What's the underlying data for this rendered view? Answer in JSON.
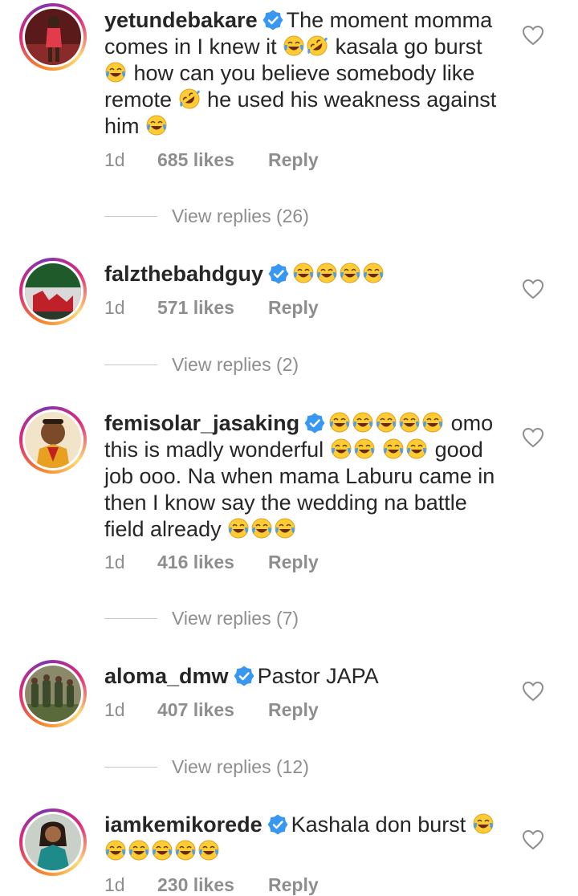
{
  "comments": [
    {
      "username": "yetundebakare",
      "segments": [
        {
          "t": "The moment momma comes in I knew it "
        },
        {
          "e": "joy"
        },
        {
          "e": "rofl"
        },
        {
          "t": " kasala go burst "
        },
        {
          "e": "joy"
        },
        {
          "t": " how can you believe somebody like remote "
        },
        {
          "e": "rofl"
        },
        {
          "t": " he used his weakness against him "
        },
        {
          "e": "joy"
        }
      ],
      "age": "1d",
      "likes": "685 likes",
      "reply": "Reply",
      "view_replies": "View replies (26)"
    },
    {
      "username": "falzthebahdguy",
      "segments": [
        {
          "e": "joy"
        },
        {
          "e": "joy"
        },
        {
          "e": "joy"
        },
        {
          "e": "joy"
        }
      ],
      "age": "1d",
      "likes": "571 likes",
      "reply": "Reply",
      "view_replies": "View replies (2)"
    },
    {
      "username": "femisolar_jasaking",
      "segments": [
        {
          "e": "joy"
        },
        {
          "e": "joy"
        },
        {
          "e": "joy"
        },
        {
          "e": "joy"
        },
        {
          "e": "joy"
        },
        {
          "t": " omo this is madly wonderful "
        },
        {
          "e": "joy"
        },
        {
          "e": "joy"
        },
        {
          "t": " "
        },
        {
          "e": "joy"
        },
        {
          "e": "joy"
        },
        {
          "t": " good job ooo. Na when mama Laburu came in then I know say the wedding na battle field already "
        },
        {
          "e": "joy"
        },
        {
          "e": "joy"
        },
        {
          "e": "joy"
        }
      ],
      "age": "1d",
      "likes": "416 likes",
      "reply": "Reply",
      "view_replies": "View replies (7)"
    },
    {
      "username": "aloma_dmw",
      "segments": [
        {
          "t": "Pastor JAPA"
        }
      ],
      "age": "1d",
      "likes": "407 likes",
      "reply": "Reply",
      "view_replies": "View replies (12)"
    },
    {
      "username": "iamkemikorede",
      "segments": [
        {
          "t": "Kashala don burst "
        },
        {
          "e": "joy"
        },
        {
          "e": "joy"
        },
        {
          "e": "joy"
        },
        {
          "e": "joy"
        },
        {
          "e": "joy"
        },
        {
          "e": "joy"
        }
      ],
      "age": "1d",
      "likes": "230 likes",
      "reply": "Reply",
      "view_replies": ""
    }
  ],
  "icons": {
    "verified": "verified-badge-icon",
    "heart": "heart-outline-icon",
    "joy": "face-with-tears-of-joy-emoji",
    "rofl": "rolling-on-floor-laughing-emoji"
  },
  "colors": {
    "verified": "#3897f0",
    "muted": "#8e8e8e",
    "text": "#262626"
  }
}
